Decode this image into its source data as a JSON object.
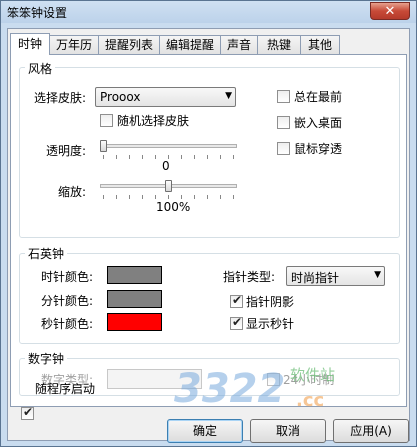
{
  "window": {
    "title": "笨笨钟设置",
    "close_label": "✕"
  },
  "tabs": [
    {
      "label": "时钟",
      "active": true
    },
    {
      "label": "万年历"
    },
    {
      "label": "提醒列表"
    },
    {
      "label": "编辑提醒"
    },
    {
      "label": "声音"
    },
    {
      "label": "热键"
    },
    {
      "label": "其他"
    }
  ],
  "style_group": {
    "title": "风格",
    "skin_label": "选择皮肤:",
    "skin_value": "Prooox",
    "random_skin_label": "随机选择皮肤",
    "always_on_top_label": "总在最前",
    "embed_desktop_label": "嵌入桌面",
    "mouse_through_label": "鼠标穿透",
    "opacity_label": "透明度:",
    "opacity_value": "0",
    "opacity_level": 0,
    "scale_label": "缩放:",
    "scale_value": "100%",
    "scale_level": 0.5
  },
  "quartz_group": {
    "title": "石英钟",
    "hour_color_label": "时针颜色:",
    "minute_color_label": "分针颜色:",
    "second_color_label": "秒针颜色:",
    "hour_color": "#808080",
    "minute_color": "#808080",
    "second_color": "#ff0000",
    "hand_type_label": "指针类型:",
    "hand_type_value": "时尚指针",
    "hand_shadow_label": "指针阴影",
    "show_second_label": "显示秒针"
  },
  "digital_group": {
    "title": "数字钟",
    "digital_type_label": "数字类型:",
    "hour24_label": "24小时制"
  },
  "startup_label": "随程序启动",
  "buttons": {
    "ok": "确定",
    "cancel": "取消",
    "apply": "应用(A)"
  },
  "watermark": {
    "number": "3322",
    "site": "软件站",
    "domain": ".cc"
  }
}
